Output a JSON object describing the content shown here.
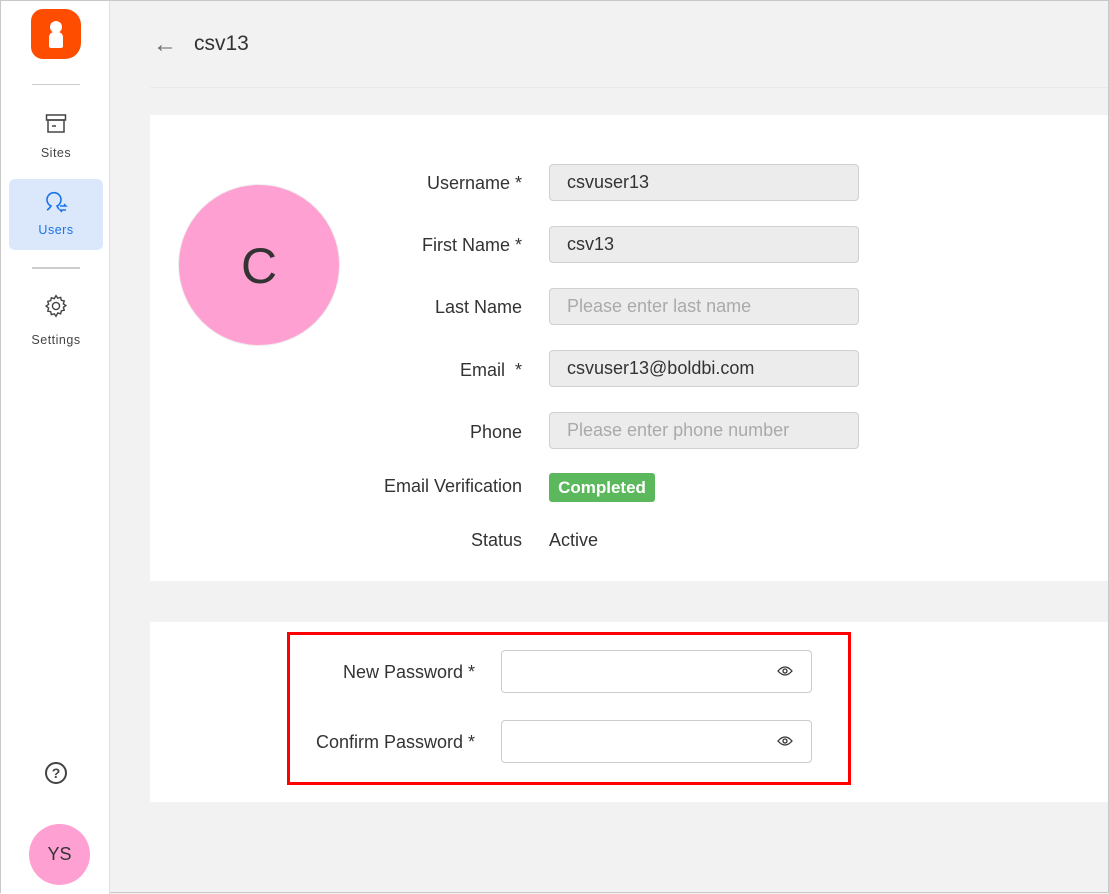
{
  "sidebar": {
    "items": [
      {
        "label": "Sites",
        "icon": "archive-icon"
      },
      {
        "label": "Users",
        "icon": "users-icon",
        "active": true
      },
      {
        "label": "Settings",
        "icon": "gear-icon"
      }
    ],
    "help_icon": "?",
    "user_initials": "YS"
  },
  "header": {
    "title": "csv13"
  },
  "profile": {
    "avatar_letter": "C",
    "fields": [
      {
        "label": "Username *",
        "value": "csvuser13",
        "placeholder": ""
      },
      {
        "label": "First Name *",
        "value": "csv13",
        "placeholder": ""
      },
      {
        "label": "Last Name",
        "value": "",
        "placeholder": "Please enter last name"
      },
      {
        "label": "Email  *",
        "value": "csvuser13@boldbi.com",
        "placeholder": ""
      },
      {
        "label": "Phone",
        "value": "",
        "placeholder": "Please enter phone number"
      }
    ],
    "email_verification_label": "Email Verification",
    "email_verification_badge": "Completed",
    "status_label": "Status",
    "status_value": "Active"
  },
  "password": {
    "new_label": "New Password *",
    "confirm_label": "Confirm Password *"
  },
  "colors": {
    "brand": "#ff4d00",
    "active": "#1a73e8",
    "badge": "#5cb85c",
    "highlight": "#ff0000"
  }
}
